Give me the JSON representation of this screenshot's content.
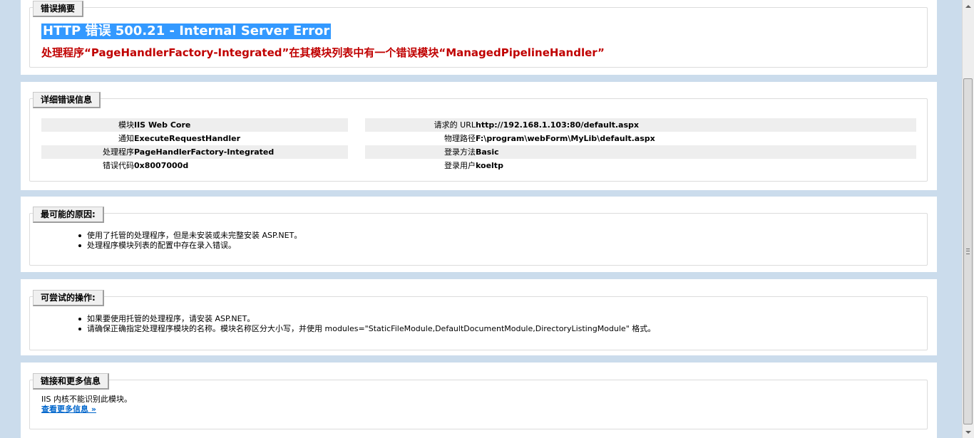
{
  "summary": {
    "legend": "错误摘要",
    "title": "HTTP 错误 500.21 - Internal Server Error",
    "message": "处理程序“PageHandlerFactory-Integrated”在其模块列表中有一个错误模块“ManagedPipelineHandler”"
  },
  "details": {
    "legend": "详细错误信息",
    "left": [
      {
        "label": "模块",
        "value": "IIS Web Core"
      },
      {
        "label": "通知",
        "value": "ExecuteRequestHandler"
      },
      {
        "label": "处理程序",
        "value": "PageHandlerFactory-Integrated"
      },
      {
        "label": "错误代码",
        "value": "0x8007000d"
      }
    ],
    "right": [
      {
        "label": "请求的 URL",
        "value": "http://192.168.1.103:80/default.aspx"
      },
      {
        "label": "物理路径",
        "value": "F:\\program\\webForm\\MyLib\\default.aspx"
      },
      {
        "label": "登录方法",
        "value": "Basic"
      },
      {
        "label": "登录用户",
        "value": "koeltp"
      }
    ]
  },
  "causes": {
    "legend": "最可能的原因:",
    "items": [
      "使用了托管的处理程序，但是未安装或未完整安装 ASP.NET。",
      "处理程序模块列表的配置中存在录入错误。"
    ]
  },
  "actions": {
    "legend": "可尝试的操作:",
    "items": [
      "如果要使用托管的处理程序，请安装 ASP.NET。",
      "请确保正确指定处理程序模块的名称。模块名称区分大小写，并使用 modules=\"StaticFileModule,DefaultDocumentModule,DirectoryListingModule\" 格式。"
    ]
  },
  "links": {
    "legend": "链接和更多信息",
    "text": "IIS 内核不能识别此模块。",
    "more_label": "查看更多信息 »"
  },
  "colors": {
    "page_background": "#cbdcec",
    "title_highlight": "#3399ff",
    "error_text": "#c00000",
    "link": "#0066cc"
  }
}
